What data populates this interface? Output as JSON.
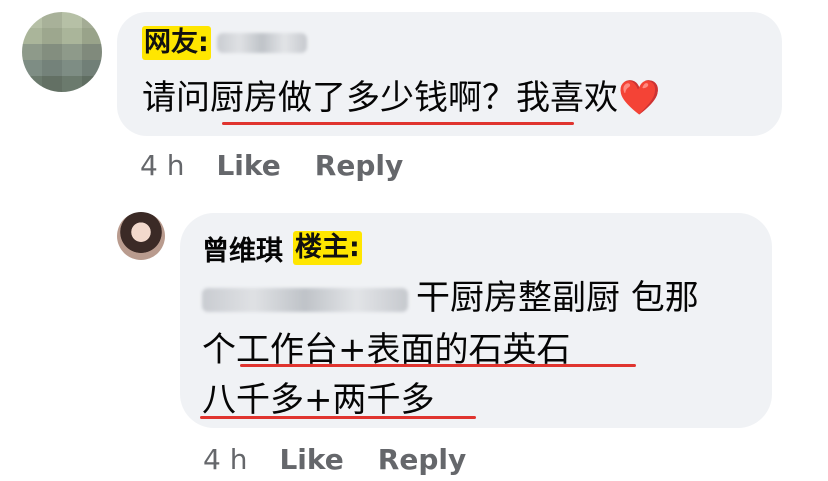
{
  "comments": [
    {
      "tag": "网友:",
      "text": "请问厨房做了多少钱啊？我喜欢",
      "emoji": "❤️",
      "time": "4 h",
      "like": "Like",
      "reply": "Reply"
    }
  ],
  "reply": {
    "author": "曾维琪",
    "tag": "楼主:",
    "line1": "干厨房整副厨 包那",
    "line2": "个工作台+表面的石英石",
    "line3": "八千多+两千多",
    "time": "4 h",
    "like": "Like",
    "reply": "Reply"
  },
  "colors": {
    "bubble": "#f0f2f5",
    "tag_highlight": "#ffe600",
    "underline": "#e0342f",
    "meta_text": "#65676b"
  }
}
